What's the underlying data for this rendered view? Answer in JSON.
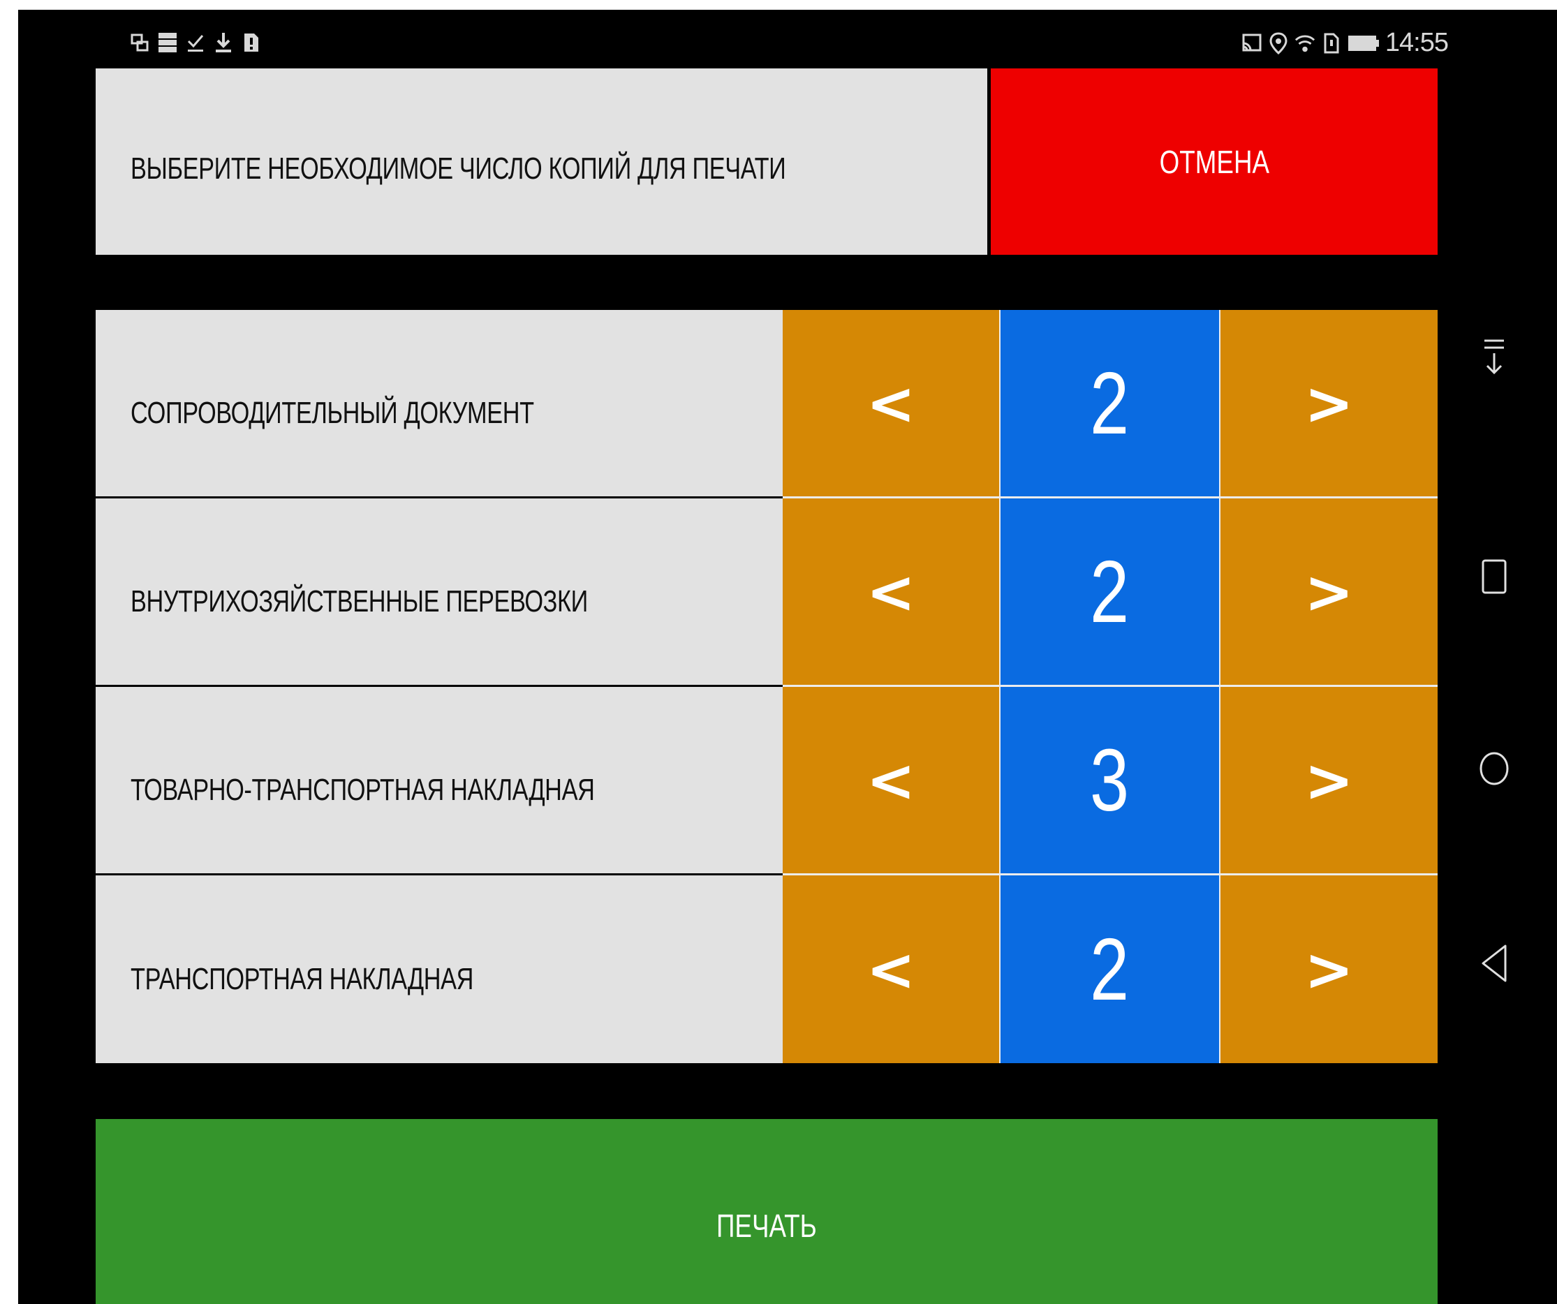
{
  "status_bar": {
    "time": "14:55",
    "left_icons": [
      "cast-icon",
      "storage-icon",
      "checklist-icon",
      "download-icon",
      "sim-alert-icon"
    ],
    "right_icons": [
      "screen-cast-icon",
      "location-icon",
      "wifi-icon",
      "sim-icon",
      "battery-icon"
    ]
  },
  "header": {
    "title": "ВЫБЕРИТЕ НЕОБХОДИМОЕ ЧИСЛО КОПИЙ ДЛЯ ПЕЧАТИ",
    "cancel_label": "ОТМЕНА"
  },
  "documents": [
    {
      "label": "СОПРОВОДИТЕЛЬНЫЙ ДОКУМЕНТ",
      "copies": "2",
      "dec": "<",
      "inc": ">"
    },
    {
      "label": "ВНУТРИХОЗЯЙСТВЕННЫЕ ПЕРЕВОЗКИ",
      "copies": "2",
      "dec": "<",
      "inc": ">"
    },
    {
      "label": "ТОВАРНО-ТРАНСПОРТНАЯ НАКЛАДНАЯ",
      "copies": "3",
      "dec": "<",
      "inc": ">"
    },
    {
      "label": "ТРАНСПОРТНАЯ НАКЛАДНАЯ",
      "copies": "2",
      "dec": "<",
      "inc": ">"
    }
  ],
  "print_label": "ПЕЧАТЬ",
  "nav": [
    "notification-pull-icon",
    "recents-icon",
    "home-icon",
    "back-icon"
  ],
  "colors": {
    "background": "#000000",
    "panel": "#e2e2e2",
    "cancel": "#ee0000",
    "stepper": "#d58805",
    "count": "#0a6be1",
    "print": "#35952c"
  }
}
